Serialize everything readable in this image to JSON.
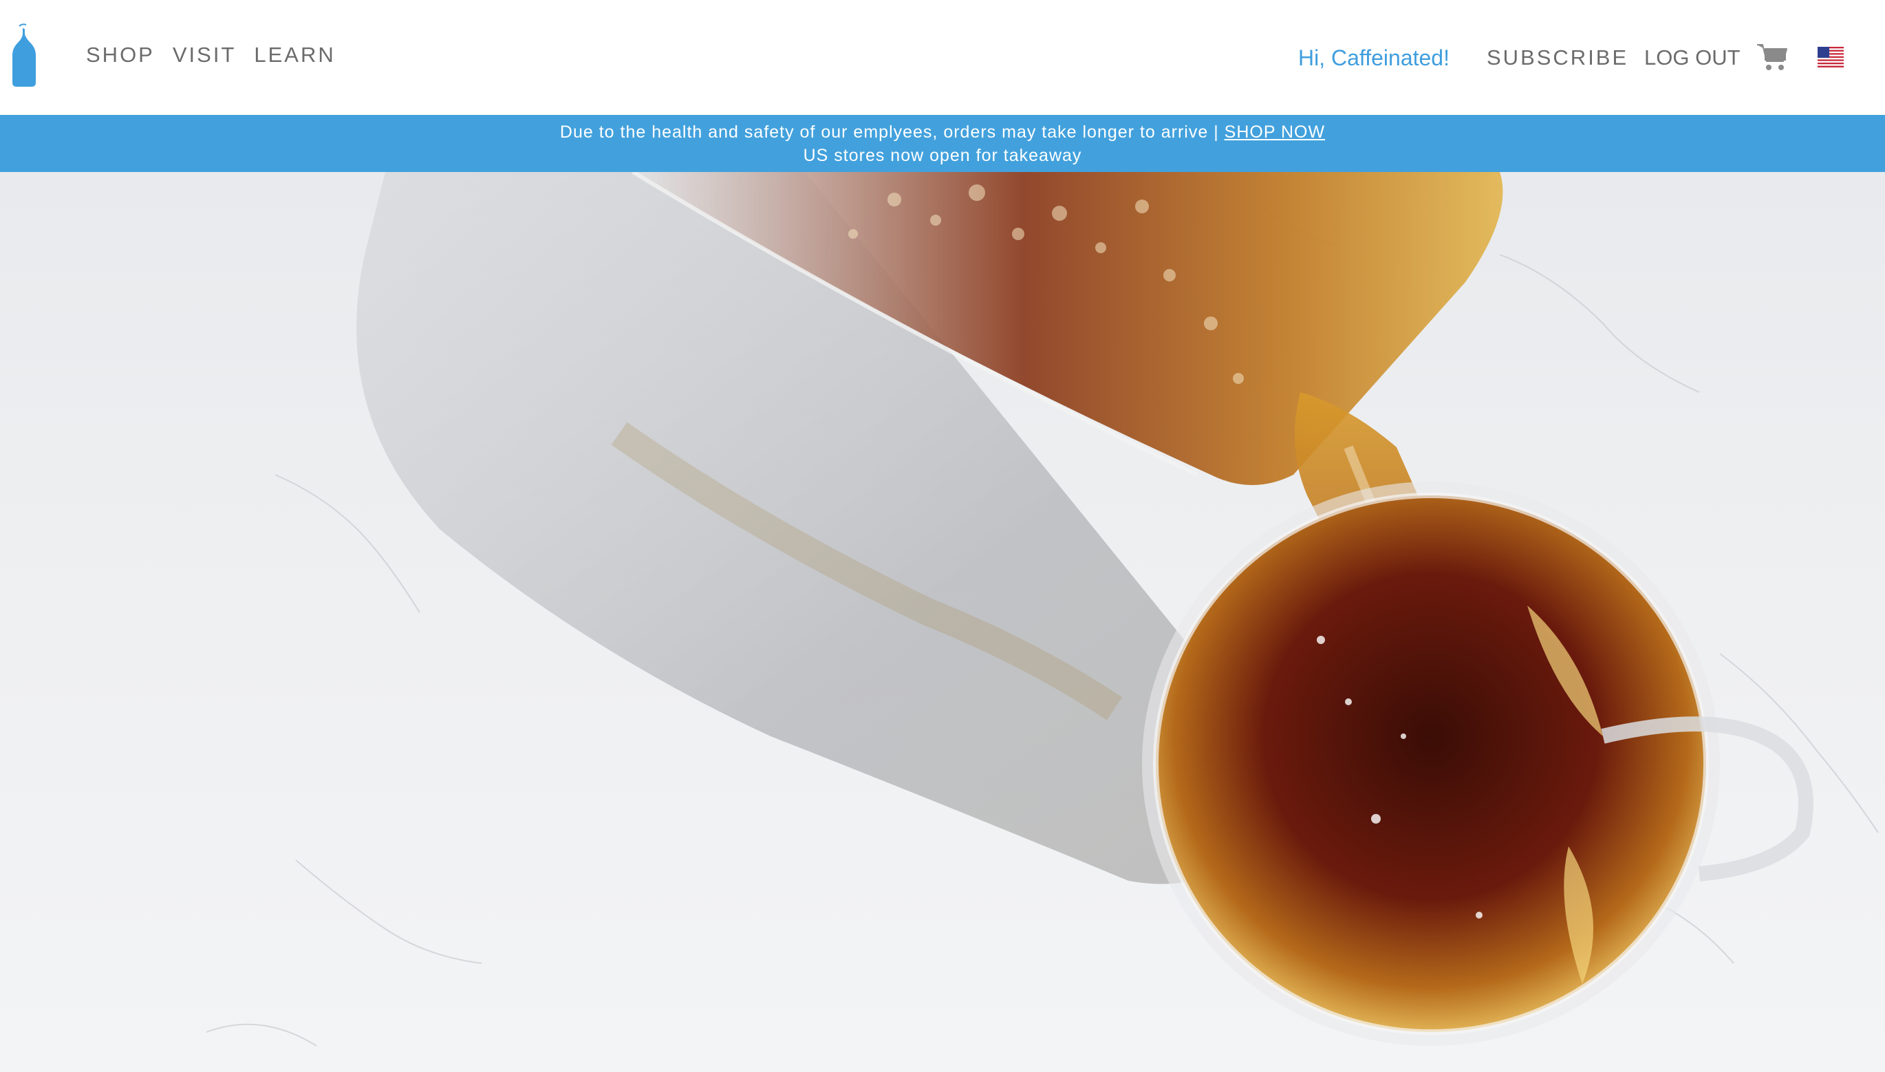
{
  "header": {
    "logo_icon": "blue-bottle-logo-icon",
    "nav": [
      {
        "label": "SHOP"
      },
      {
        "label": "VISIT"
      },
      {
        "label": "LEARN"
      }
    ],
    "greeting": "Hi, Caffeinated!",
    "subscribe_label": "SUBSCRIBE",
    "logout_label": "LOG OUT",
    "cart_icon": "cart-icon",
    "flag_icon": "us-flag-icon"
  },
  "banner": {
    "line1_text": "Due to the health and safety of our emplyees, orders may take longer to arrive | ",
    "line1_link": "SHOP NOW",
    "line2_text": "US stores now open for takeaway"
  },
  "colors": {
    "accent": "#42a1dd",
    "greeting": "#3f9ede",
    "nav_text": "#6b6b6b"
  }
}
